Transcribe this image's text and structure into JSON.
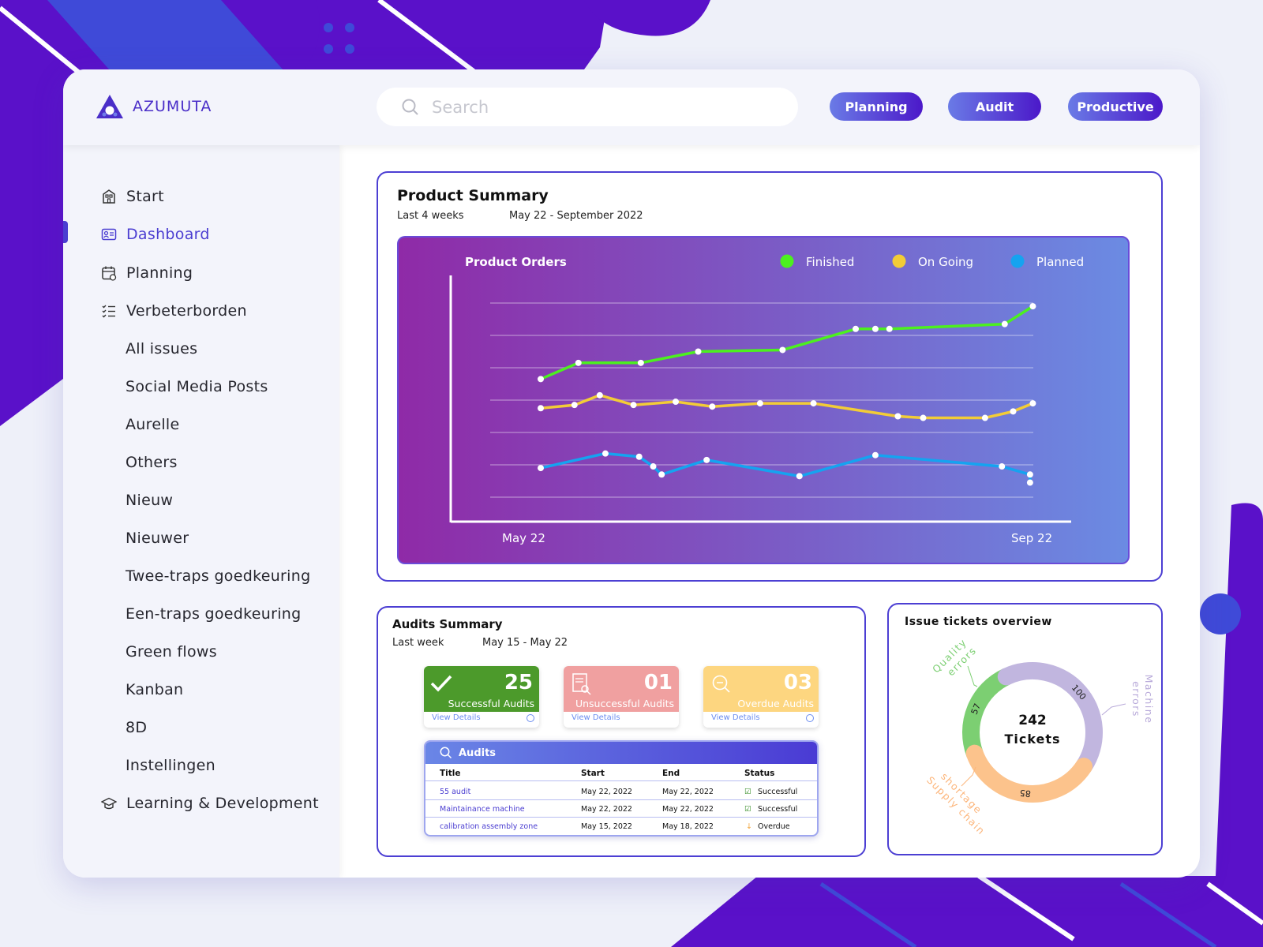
{
  "brand": {
    "name": "AZUMUTA"
  },
  "search": {
    "placeholder": "Search"
  },
  "header_buttons": [
    "Planning",
    "Audit",
    "Productive"
  ],
  "sidebar": {
    "items": [
      {
        "label": "Start",
        "icon": "building-icon"
      },
      {
        "label": "Dashboard",
        "icon": "id-card-icon",
        "active": true
      },
      {
        "label": "Planning",
        "icon": "calendar-icon"
      },
      {
        "label": "Verbeterborden",
        "icon": "checklist-icon"
      },
      {
        "label": "All issues"
      },
      {
        "label": "Social Media Posts"
      },
      {
        "label": "Aurelle"
      },
      {
        "label": "Others"
      },
      {
        "label": "Nieuw"
      },
      {
        "label": "Nieuwer"
      },
      {
        "label": "Twee-traps goedkeuring"
      },
      {
        "label": "Een-traps goedkeuring"
      },
      {
        "label": "Green flows"
      },
      {
        "label": "Kanban"
      },
      {
        "label": "8D"
      },
      {
        "label": "Instellingen"
      },
      {
        "label": "Learning & Development",
        "icon": "graduation-cap-icon"
      }
    ]
  },
  "product_summary": {
    "title": "Product Summary",
    "range_label": "Last 4 weeks",
    "date_range": "May 22 - September 2022",
    "chart_title": "Product Orders"
  },
  "chart_data": {
    "type": "line",
    "title": "Product Orders",
    "x_start_label": "May 22",
    "x_end_label": "Sep 22",
    "xlim": [
      0,
      100
    ],
    "ylim": [
      0,
      8
    ],
    "grid": true,
    "legend_position": "top-right",
    "series": [
      {
        "name": "Finished",
        "color": "#4cf01f",
        "points": [
          [
            0,
            4.65
          ],
          [
            6.7,
            5.15
          ],
          [
            17.8,
            5.15
          ],
          [
            28,
            5.5
          ],
          [
            43,
            5.55
          ],
          [
            56,
            6.2
          ],
          [
            59.5,
            6.2
          ],
          [
            62,
            6.2
          ],
          [
            82.5,
            6.35
          ],
          [
            87.5,
            6.9
          ]
        ]
      },
      {
        "name": "On Going",
        "color": "#f2cc37",
        "points": [
          [
            0,
            3.75
          ],
          [
            6,
            3.85
          ],
          [
            10.5,
            4.15
          ],
          [
            16.5,
            3.85
          ],
          [
            24,
            3.95
          ],
          [
            30.5,
            3.8
          ],
          [
            39,
            3.9
          ],
          [
            48.5,
            3.9
          ],
          [
            63.5,
            3.5
          ],
          [
            68,
            3.45
          ],
          [
            79,
            3.45
          ],
          [
            84,
            3.65
          ],
          [
            87.5,
            3.9
          ]
        ]
      },
      {
        "name": "Planned",
        "color": "#15a3f0",
        "points": [
          [
            0,
            1.9
          ],
          [
            11.5,
            2.35
          ],
          [
            17.5,
            2.25
          ],
          [
            20,
            1.95
          ],
          [
            21.5,
            1.7
          ],
          [
            29.5,
            2.15
          ],
          [
            46,
            1.65
          ],
          [
            59.5,
            2.3
          ],
          [
            82,
            1.95
          ],
          [
            87,
            1.7
          ],
          [
            87,
            1.45
          ]
        ]
      }
    ]
  },
  "audits_summary": {
    "title": "Audits Summary",
    "range_label": "Last week",
    "date_range": "May 15 - May 22",
    "tiles": [
      {
        "count": "25",
        "label": "Successful Audits",
        "link": "View Details",
        "color": "#4c9a2b"
      },
      {
        "count": "01",
        "label": "Unsuccessful Audits",
        "link": "View Details",
        "color": "#f0a0a0"
      },
      {
        "count": "03",
        "label": "Overdue Audits",
        "link": "View Details",
        "color": "#fdd680"
      }
    ],
    "table": {
      "title": "Audits",
      "columns": [
        "Title",
        "Start",
        "End",
        "Status"
      ],
      "rows": [
        {
          "title": "55 audit",
          "start": "May 22, 2022",
          "end": "May 22, 2022",
          "status": "Successful"
        },
        {
          "title": "Maintainance machine",
          "start": "May 22, 2022",
          "end": "May 22, 2022",
          "status": "Successful"
        },
        {
          "title": "calibration assembly zone",
          "start": "May 15, 2022",
          "end": "May 18, 2022",
          "status": "Overdue"
        }
      ]
    }
  },
  "issue_tickets": {
    "title": "Issue tickets overview",
    "total": "242",
    "total_label": "Tickets",
    "segments": [
      {
        "label_line1": "Quality",
        "label_line2": "errors",
        "value": 57,
        "color": "#7ccf72"
      },
      {
        "label_line1": "Machine",
        "label_line2": "errors",
        "value": 100,
        "color": "#c1b6df"
      },
      {
        "label_line1": "Supply chain",
        "label_line2": "shortage",
        "value": 85,
        "color": "#fcc38c"
      }
    ]
  }
}
